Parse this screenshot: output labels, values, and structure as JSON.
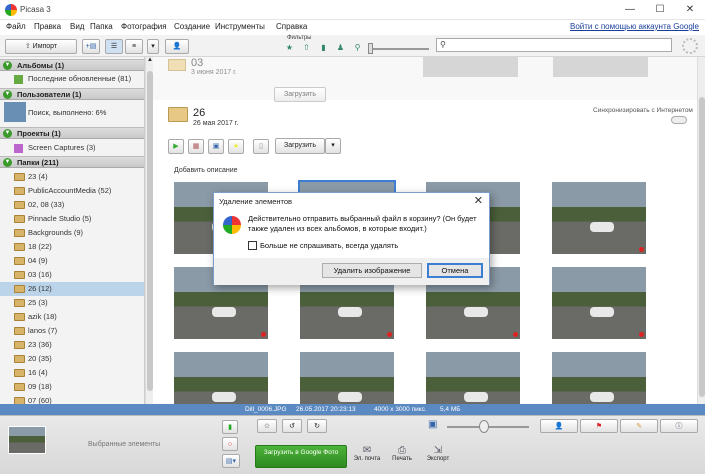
{
  "window": {
    "title": "Picasa 3"
  },
  "menu": [
    "Файл",
    "Правка",
    "Вид",
    "Папка",
    "Фотография",
    "Создание",
    "Инструменты",
    "Справка"
  ],
  "account_link": "Войти с помощью аккаунта Google",
  "toolbar": {
    "import_label": "Импорт",
    "filters_label": "Фильтры"
  },
  "sections": {
    "albums": "Альбомы (1)",
    "albums_item": "Последние обновленные (81)",
    "users": "Пользователи (1)",
    "users_item": "Поиск, выполнено: 6%",
    "projects": "Проекты (1)",
    "projects_item": "Screen Captures (3)",
    "folders": "Папки (211)"
  },
  "folders": [
    "23 (4)",
    "PublicAccountMedia (52)",
    "02, 08 (33)",
    "Pinnacle Studio (5)",
    "Backgrounds (9)",
    "18 (22)",
    "04 (9)",
    "03 (16)",
    "26 (12)",
    "25 (3)",
    "azik (18)",
    "lanos (7)",
    "23 (36)",
    "20 (35)",
    "16 (4)",
    "09 (18)",
    "07 (60)"
  ],
  "main": {
    "prev_folder_num": "03",
    "prev_folder_date": "3 июня 2017 г.",
    "upload_label": "Загрузить",
    "folder_num": "26",
    "folder_date": "26 мая 2017 г.",
    "sync_label": "Синхронизировать с Интернетом",
    "add_description": "Добавить описание"
  },
  "status": {
    "filename": "Dill_0006.JPG",
    "datetime": "26.05.2017 20:23:13",
    "dims": "4000 x 3000 пикс.",
    "size": "5,4 МБ"
  },
  "tray": {
    "selected_label": "Выбранные элементы",
    "upload_btn": "Загрузить в Google Фото",
    "email": "Эл. почта",
    "print": "Печать",
    "export": "Экспорт"
  },
  "dialog": {
    "title": "Удаление элементов",
    "message": "Действительно отправить выбранный файл в корзину? (Он будет также удален из всех альбомов, в которые входит.)",
    "checkbox": "Больше не спрашивать, всегда удалять",
    "delete_btn": "Удалить изображение",
    "cancel_btn": "Отмена"
  },
  "colors": {
    "accent": "#5b8ac2",
    "section_green": "#3a9a2a",
    "upload_green": "#3a9a2a"
  }
}
